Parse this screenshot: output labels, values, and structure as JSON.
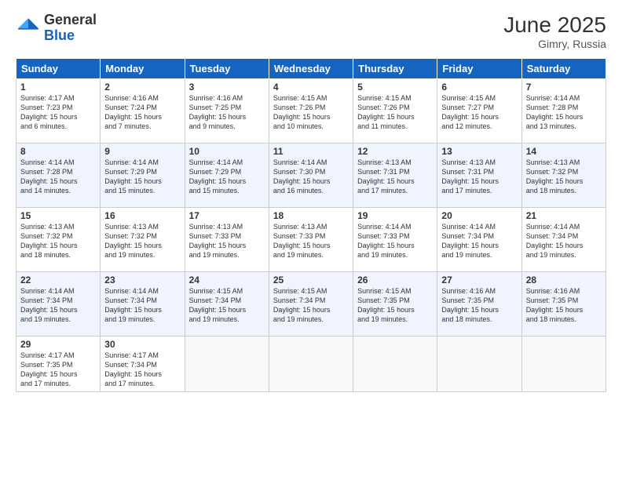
{
  "logo": {
    "general": "General",
    "blue": "Blue"
  },
  "header": {
    "month": "June 2025",
    "location": "Gimry, Russia"
  },
  "weekdays": [
    "Sunday",
    "Monday",
    "Tuesday",
    "Wednesday",
    "Thursday",
    "Friday",
    "Saturday"
  ],
  "weeks": [
    [
      {
        "day": "1",
        "sunrise": "4:17 AM",
        "sunset": "7:23 PM",
        "daylight": "15 hours and 6 minutes."
      },
      {
        "day": "2",
        "sunrise": "4:16 AM",
        "sunset": "7:24 PM",
        "daylight": "15 hours and 7 minutes."
      },
      {
        "day": "3",
        "sunrise": "4:16 AM",
        "sunset": "7:25 PM",
        "daylight": "15 hours and 9 minutes."
      },
      {
        "day": "4",
        "sunrise": "4:15 AM",
        "sunset": "7:26 PM",
        "daylight": "15 hours and 10 minutes."
      },
      {
        "day": "5",
        "sunrise": "4:15 AM",
        "sunset": "7:26 PM",
        "daylight": "15 hours and 11 minutes."
      },
      {
        "day": "6",
        "sunrise": "4:15 AM",
        "sunset": "7:27 PM",
        "daylight": "15 hours and 12 minutes."
      },
      {
        "day": "7",
        "sunrise": "4:14 AM",
        "sunset": "7:28 PM",
        "daylight": "15 hours and 13 minutes."
      }
    ],
    [
      {
        "day": "8",
        "sunrise": "4:14 AM",
        "sunset": "7:28 PM",
        "daylight": "15 hours and 14 minutes."
      },
      {
        "day": "9",
        "sunrise": "4:14 AM",
        "sunset": "7:29 PM",
        "daylight": "15 hours and 15 minutes."
      },
      {
        "day": "10",
        "sunrise": "4:14 AM",
        "sunset": "7:29 PM",
        "daylight": "15 hours and 15 minutes."
      },
      {
        "day": "11",
        "sunrise": "4:14 AM",
        "sunset": "7:30 PM",
        "daylight": "15 hours and 16 minutes."
      },
      {
        "day": "12",
        "sunrise": "4:13 AM",
        "sunset": "7:31 PM",
        "daylight": "15 hours and 17 minutes."
      },
      {
        "day": "13",
        "sunrise": "4:13 AM",
        "sunset": "7:31 PM",
        "daylight": "15 hours and 17 minutes."
      },
      {
        "day": "14",
        "sunrise": "4:13 AM",
        "sunset": "7:32 PM",
        "daylight": "15 hours and 18 minutes."
      }
    ],
    [
      {
        "day": "15",
        "sunrise": "4:13 AM",
        "sunset": "7:32 PM",
        "daylight": "15 hours and 18 minutes."
      },
      {
        "day": "16",
        "sunrise": "4:13 AM",
        "sunset": "7:32 PM",
        "daylight": "15 hours and 19 minutes."
      },
      {
        "day": "17",
        "sunrise": "4:13 AM",
        "sunset": "7:33 PM",
        "daylight": "15 hours and 19 minutes."
      },
      {
        "day": "18",
        "sunrise": "4:13 AM",
        "sunset": "7:33 PM",
        "daylight": "15 hours and 19 minutes."
      },
      {
        "day": "19",
        "sunrise": "4:14 AM",
        "sunset": "7:33 PM",
        "daylight": "15 hours and 19 minutes."
      },
      {
        "day": "20",
        "sunrise": "4:14 AM",
        "sunset": "7:34 PM",
        "daylight": "15 hours and 19 minutes."
      },
      {
        "day": "21",
        "sunrise": "4:14 AM",
        "sunset": "7:34 PM",
        "daylight": "15 hours and 19 minutes."
      }
    ],
    [
      {
        "day": "22",
        "sunrise": "4:14 AM",
        "sunset": "7:34 PM",
        "daylight": "15 hours and 19 minutes."
      },
      {
        "day": "23",
        "sunrise": "4:14 AM",
        "sunset": "7:34 PM",
        "daylight": "15 hours and 19 minutes."
      },
      {
        "day": "24",
        "sunrise": "4:15 AM",
        "sunset": "7:34 PM",
        "daylight": "15 hours and 19 minutes."
      },
      {
        "day": "25",
        "sunrise": "4:15 AM",
        "sunset": "7:34 PM",
        "daylight": "15 hours and 19 minutes."
      },
      {
        "day": "26",
        "sunrise": "4:15 AM",
        "sunset": "7:35 PM",
        "daylight": "15 hours and 19 minutes."
      },
      {
        "day": "27",
        "sunrise": "4:16 AM",
        "sunset": "7:35 PM",
        "daylight": "15 hours and 18 minutes."
      },
      {
        "day": "28",
        "sunrise": "4:16 AM",
        "sunset": "7:35 PM",
        "daylight": "15 hours and 18 minutes."
      }
    ],
    [
      {
        "day": "29",
        "sunrise": "4:17 AM",
        "sunset": "7:35 PM",
        "daylight": "15 hours and 17 minutes."
      },
      {
        "day": "30",
        "sunrise": "4:17 AM",
        "sunset": "7:34 PM",
        "daylight": "15 hours and 17 minutes."
      },
      null,
      null,
      null,
      null,
      null
    ]
  ],
  "labels": {
    "sunrise": "Sunrise:",
    "sunset": "Sunset:",
    "daylight": "Daylight:"
  }
}
